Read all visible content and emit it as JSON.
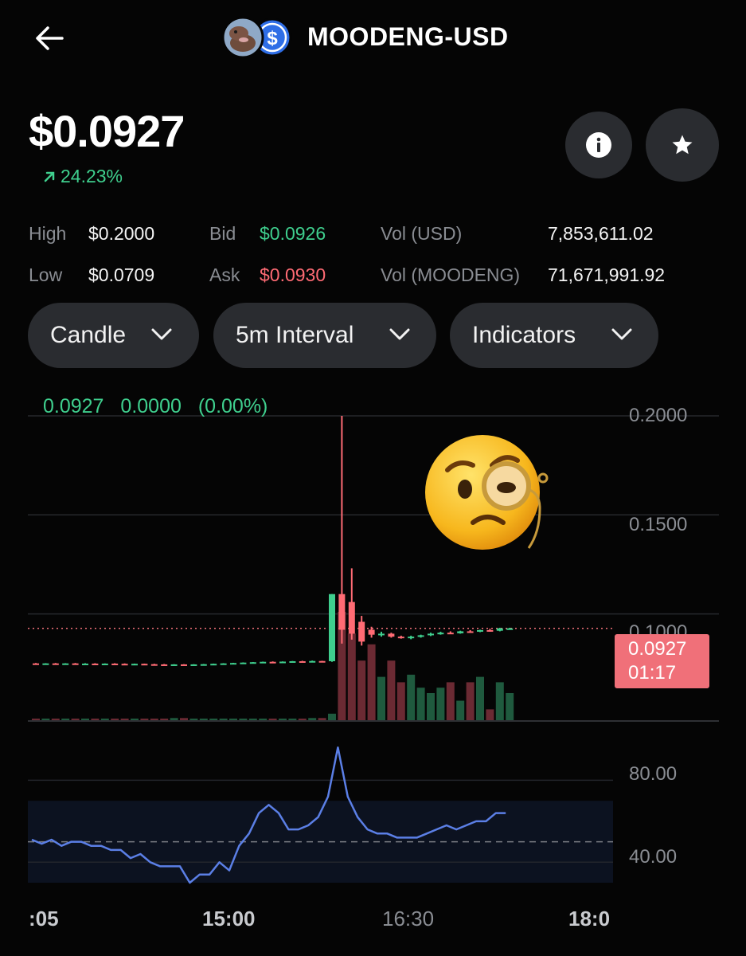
{
  "header": {
    "title": "MOODENG-USD",
    "back_icon": "arrow-left-icon",
    "coin_icon": "moodeng-coin-icon",
    "quote_icon": "usd-coin-icon"
  },
  "summary": {
    "price": "$0.0927",
    "change": "24.23%",
    "change_icon": "arrow-up-right-icon",
    "info_icon": "info-icon",
    "star_icon": "star-icon"
  },
  "stats": {
    "high_label": "High",
    "high_value": "$0.2000",
    "low_label": "Low",
    "low_value": "$0.0709",
    "bid_label": "Bid",
    "bid_value": "$0.0926",
    "ask_label": "Ask",
    "ask_value": "$0.0930",
    "vol_usd_label": "Vol (USD)",
    "vol_usd_value": "7,853,611.02",
    "vol_coin_label": "Vol (MOODENG)",
    "vol_coin_value": "71,671,991.92"
  },
  "controls": {
    "chart_type": "Candle",
    "interval": "5m Interval",
    "indicators": "Indicators"
  },
  "colors": {
    "up": "#3fcf8e",
    "down": "#ff6b74",
    "rsi_line": "#5b7fe6",
    "background": "#050505",
    "pill": "#2a2c30"
  },
  "chart_data": {
    "type": "candlestick",
    "legend": {
      "price": "0.0927",
      "change": "0.0000",
      "change_pct": "(0.00%)"
    },
    "y_axis_ticks": [
      "0.2000",
      "0.1500",
      "0.1000"
    ],
    "y_axis_values": [
      0.2,
      0.15,
      0.1
    ],
    "ylim": [
      0.06,
      0.2
    ],
    "current_price": {
      "value": 0.0927,
      "label": "0.0927",
      "countdown": "01:17"
    },
    "x_axis_ticks": [
      ":05",
      "15:00",
      "16:30",
      "18:0"
    ],
    "candles": [
      {
        "o": 0.075,
        "h": 0.0752,
        "l": 0.0748,
        "c": 0.0749
      },
      {
        "o": 0.0749,
        "h": 0.0751,
        "l": 0.0747,
        "c": 0.075
      },
      {
        "o": 0.075,
        "h": 0.0752,
        "l": 0.0748,
        "c": 0.0749
      },
      {
        "o": 0.0749,
        "h": 0.0751,
        "l": 0.0747,
        "c": 0.075
      },
      {
        "o": 0.075,
        "h": 0.0752,
        "l": 0.0748,
        "c": 0.0749
      },
      {
        "o": 0.0749,
        "h": 0.0751,
        "l": 0.0747,
        "c": 0.0749
      },
      {
        "o": 0.0749,
        "h": 0.0751,
        "l": 0.0747,
        "c": 0.0748
      },
      {
        "o": 0.0748,
        "h": 0.075,
        "l": 0.0746,
        "c": 0.0749
      },
      {
        "o": 0.0749,
        "h": 0.0751,
        "l": 0.0747,
        "c": 0.0748
      },
      {
        "o": 0.0748,
        "h": 0.075,
        "l": 0.0745,
        "c": 0.0747
      },
      {
        "o": 0.0747,
        "h": 0.0749,
        "l": 0.0745,
        "c": 0.0748
      },
      {
        "o": 0.0748,
        "h": 0.0749,
        "l": 0.0745,
        "c": 0.0746
      },
      {
        "o": 0.0746,
        "h": 0.0748,
        "l": 0.0744,
        "c": 0.0745
      },
      {
        "o": 0.0745,
        "h": 0.0747,
        "l": 0.0743,
        "c": 0.0744
      },
      {
        "o": 0.0744,
        "h": 0.0746,
        "l": 0.0742,
        "c": 0.0745
      },
      {
        "o": 0.0745,
        "h": 0.0746,
        "l": 0.0743,
        "c": 0.0744
      },
      {
        "o": 0.0744,
        "h": 0.0746,
        "l": 0.0742,
        "c": 0.0745
      },
      {
        "o": 0.0745,
        "h": 0.0747,
        "l": 0.0743,
        "c": 0.0746
      },
      {
        "o": 0.0746,
        "h": 0.0749,
        "l": 0.0745,
        "c": 0.0748
      },
      {
        "o": 0.0748,
        "h": 0.0751,
        "l": 0.0747,
        "c": 0.075
      },
      {
        "o": 0.075,
        "h": 0.0753,
        "l": 0.0749,
        "c": 0.0752
      },
      {
        "o": 0.0752,
        "h": 0.0755,
        "l": 0.075,
        "c": 0.0754
      },
      {
        "o": 0.0754,
        "h": 0.0757,
        "l": 0.0752,
        "c": 0.0756
      },
      {
        "o": 0.0756,
        "h": 0.0759,
        "l": 0.0754,
        "c": 0.0758
      },
      {
        "o": 0.0758,
        "h": 0.076,
        "l": 0.0755,
        "c": 0.0757
      },
      {
        "o": 0.0757,
        "h": 0.076,
        "l": 0.0755,
        "c": 0.0759
      },
      {
        "o": 0.0759,
        "h": 0.0762,
        "l": 0.0757,
        "c": 0.0761
      },
      {
        "o": 0.0761,
        "h": 0.0763,
        "l": 0.0758,
        "c": 0.076
      },
      {
        "o": 0.076,
        "h": 0.0764,
        "l": 0.0758,
        "c": 0.0762
      },
      {
        "o": 0.0762,
        "h": 0.0763,
        "l": 0.0759,
        "c": 0.0761
      },
      {
        "o": 0.0761,
        "h": 0.11,
        "l": 0.0758,
        "c": 0.11
      },
      {
        "o": 0.11,
        "h": 0.2,
        "l": 0.085,
        "c": 0.092
      },
      {
        "o": 0.106,
        "h": 0.123,
        "l": 0.087,
        "c": 0.09
      },
      {
        "o": 0.096,
        "h": 0.099,
        "l": 0.084,
        "c": 0.086
      },
      {
        "o": 0.092,
        "h": 0.0935,
        "l": 0.088,
        "c": 0.0895
      },
      {
        "o": 0.0895,
        "h": 0.091,
        "l": 0.0885,
        "c": 0.09
      },
      {
        "o": 0.09,
        "h": 0.0905,
        "l": 0.088,
        "c": 0.0885
      },
      {
        "o": 0.0885,
        "h": 0.089,
        "l": 0.0875,
        "c": 0.088
      },
      {
        "o": 0.088,
        "h": 0.089,
        "l": 0.0872,
        "c": 0.0885
      },
      {
        "o": 0.0885,
        "h": 0.0895,
        "l": 0.088,
        "c": 0.0892
      },
      {
        "o": 0.0892,
        "h": 0.0905,
        "l": 0.0888,
        "c": 0.09
      },
      {
        "o": 0.09,
        "h": 0.091,
        "l": 0.0895,
        "c": 0.0905
      },
      {
        "o": 0.0905,
        "h": 0.0912,
        "l": 0.0898,
        "c": 0.0902
      },
      {
        "o": 0.0902,
        "h": 0.0915,
        "l": 0.09,
        "c": 0.0912
      },
      {
        "o": 0.0912,
        "h": 0.0918,
        "l": 0.0905,
        "c": 0.091
      },
      {
        "o": 0.091,
        "h": 0.092,
        "l": 0.0908,
        "c": 0.0918
      },
      {
        "o": 0.0918,
        "h": 0.0925,
        "l": 0.091,
        "c": 0.0915
      },
      {
        "o": 0.0915,
        "h": 0.093,
        "l": 0.0912,
        "c": 0.0927
      },
      {
        "o": 0.0927,
        "h": 0.093,
        "l": 0.0924,
        "c": 0.0927
      }
    ],
    "volume": [
      1,
      1,
      1,
      1,
      1,
      1,
      1,
      1,
      1,
      1,
      1,
      1,
      1,
      1,
      2,
      2,
      1,
      1,
      1,
      1,
      1,
      1,
      1,
      1,
      1,
      1,
      1,
      1,
      2,
      2,
      6,
      100,
      80,
      55,
      70,
      40,
      55,
      35,
      42,
      30,
      25,
      30,
      35,
      18,
      35,
      40,
      10,
      35,
      25
    ],
    "volume_dir": [
      "d",
      "u",
      "d",
      "u",
      "d",
      "u",
      "d",
      "u",
      "d",
      "d",
      "u",
      "d",
      "d",
      "d",
      "u",
      "d",
      "u",
      "u",
      "u",
      "u",
      "u",
      "u",
      "u",
      "u",
      "d",
      "u",
      "u",
      "d",
      "u",
      "d",
      "u",
      "d",
      "d",
      "d",
      "d",
      "u",
      "d",
      "d",
      "u",
      "u",
      "u",
      "u",
      "d",
      "u",
      "d",
      "u",
      "d",
      "u",
      "u"
    ],
    "rsi": {
      "y_axis_ticks": [
        "80.00",
        "40.00"
      ],
      "y_axis_values": [
        80,
        40
      ],
      "ylim": [
        30,
        100
      ],
      "band": [
        30,
        70
      ],
      "midline": 50,
      "values": [
        51,
        49,
        51,
        48,
        50,
        50,
        48,
        48,
        46,
        46,
        42,
        44,
        40,
        38,
        38,
        38,
        30,
        34,
        34,
        40,
        36,
        48,
        54,
        64,
        68,
        64,
        56,
        56,
        58,
        62,
        72,
        96,
        72,
        62,
        56,
        54,
        54,
        52,
        52,
        52,
        54,
        56,
        58,
        56,
        58,
        60,
        60,
        64,
        64
      ]
    }
  }
}
